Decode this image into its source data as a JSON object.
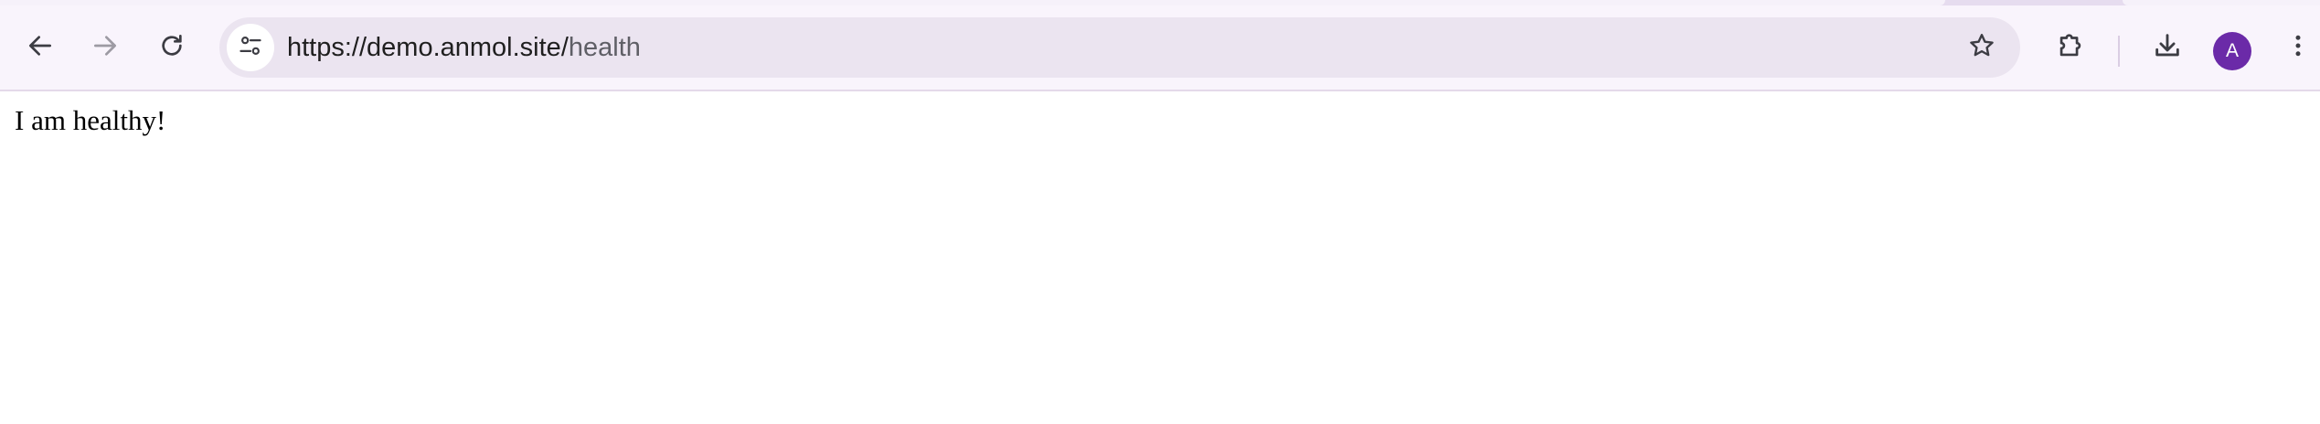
{
  "browser": {
    "url_host": "https://demo.anmol.site/",
    "url_path": "health",
    "profile_initial": "A",
    "icons": {
      "back": "arrow-left-icon",
      "forward": "arrow-right-icon",
      "reload": "reload-icon",
      "site_info": "tune-icon",
      "bookmark": "star-icon",
      "extensions": "puzzle-icon",
      "downloads": "download-icon",
      "menu": "kebab-menu-icon"
    },
    "colors": {
      "toolbar_bg": "#f9f4fc",
      "omnibox_bg": "#ebe4f0",
      "avatar_bg": "#6b2aa8",
      "forward_disabled": "#9d9aa3"
    }
  },
  "page": {
    "body_text": "I am healthy!"
  }
}
